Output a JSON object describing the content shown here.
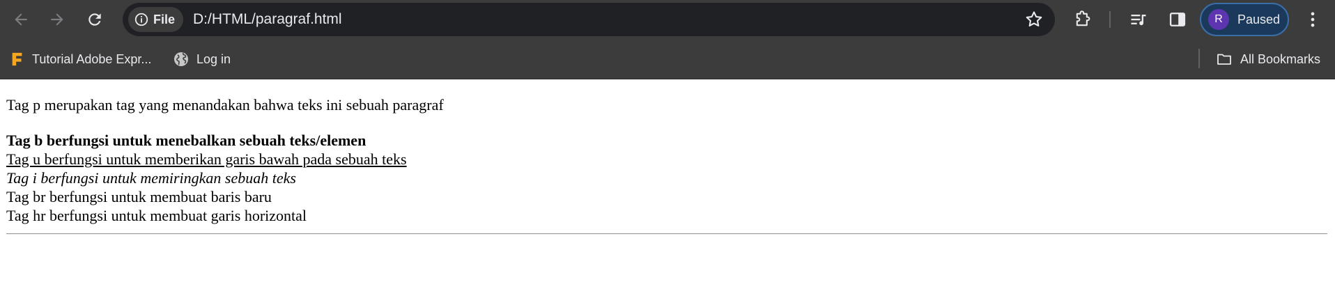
{
  "browser": {
    "site_chip_label": "File",
    "url": "D:/HTML/paragraf.html",
    "profile": {
      "initial": "R",
      "status": "Paused"
    },
    "colors": {
      "toolbar": "#3c3c3c",
      "omnibox": "#202124",
      "profile_bg": "#1b3a5b",
      "avatar": "#5e35b1",
      "bookmark_icon": "#f5a623"
    }
  },
  "bookmarks": {
    "items": [
      {
        "label": "Tutorial Adobe Expr...",
        "icon": "adobe-express-f-icon"
      },
      {
        "label": "Log in",
        "icon": "globe-icon"
      }
    ],
    "all_bookmarks": {
      "label": "All Bookmarks",
      "icon": "folder-icon"
    }
  },
  "page": {
    "paragraph": "Tag p merupakan tag yang menandakan bahwa teks ini sebuah paragraf",
    "bold_line": "Tag b berfungsi untuk menebalkan sebuah teks/elemen",
    "underline_line": "Tag u berfungsi untuk memberikan garis bawah pada sebuah teks",
    "italic_line": "Tag i berfungsi untuk memiringkan sebuah teks",
    "br_line": "Tag br berfungsi untuk membuat baris baru",
    "hr_line": "Tag hr berfungsi untuk membuat garis horizontal"
  }
}
